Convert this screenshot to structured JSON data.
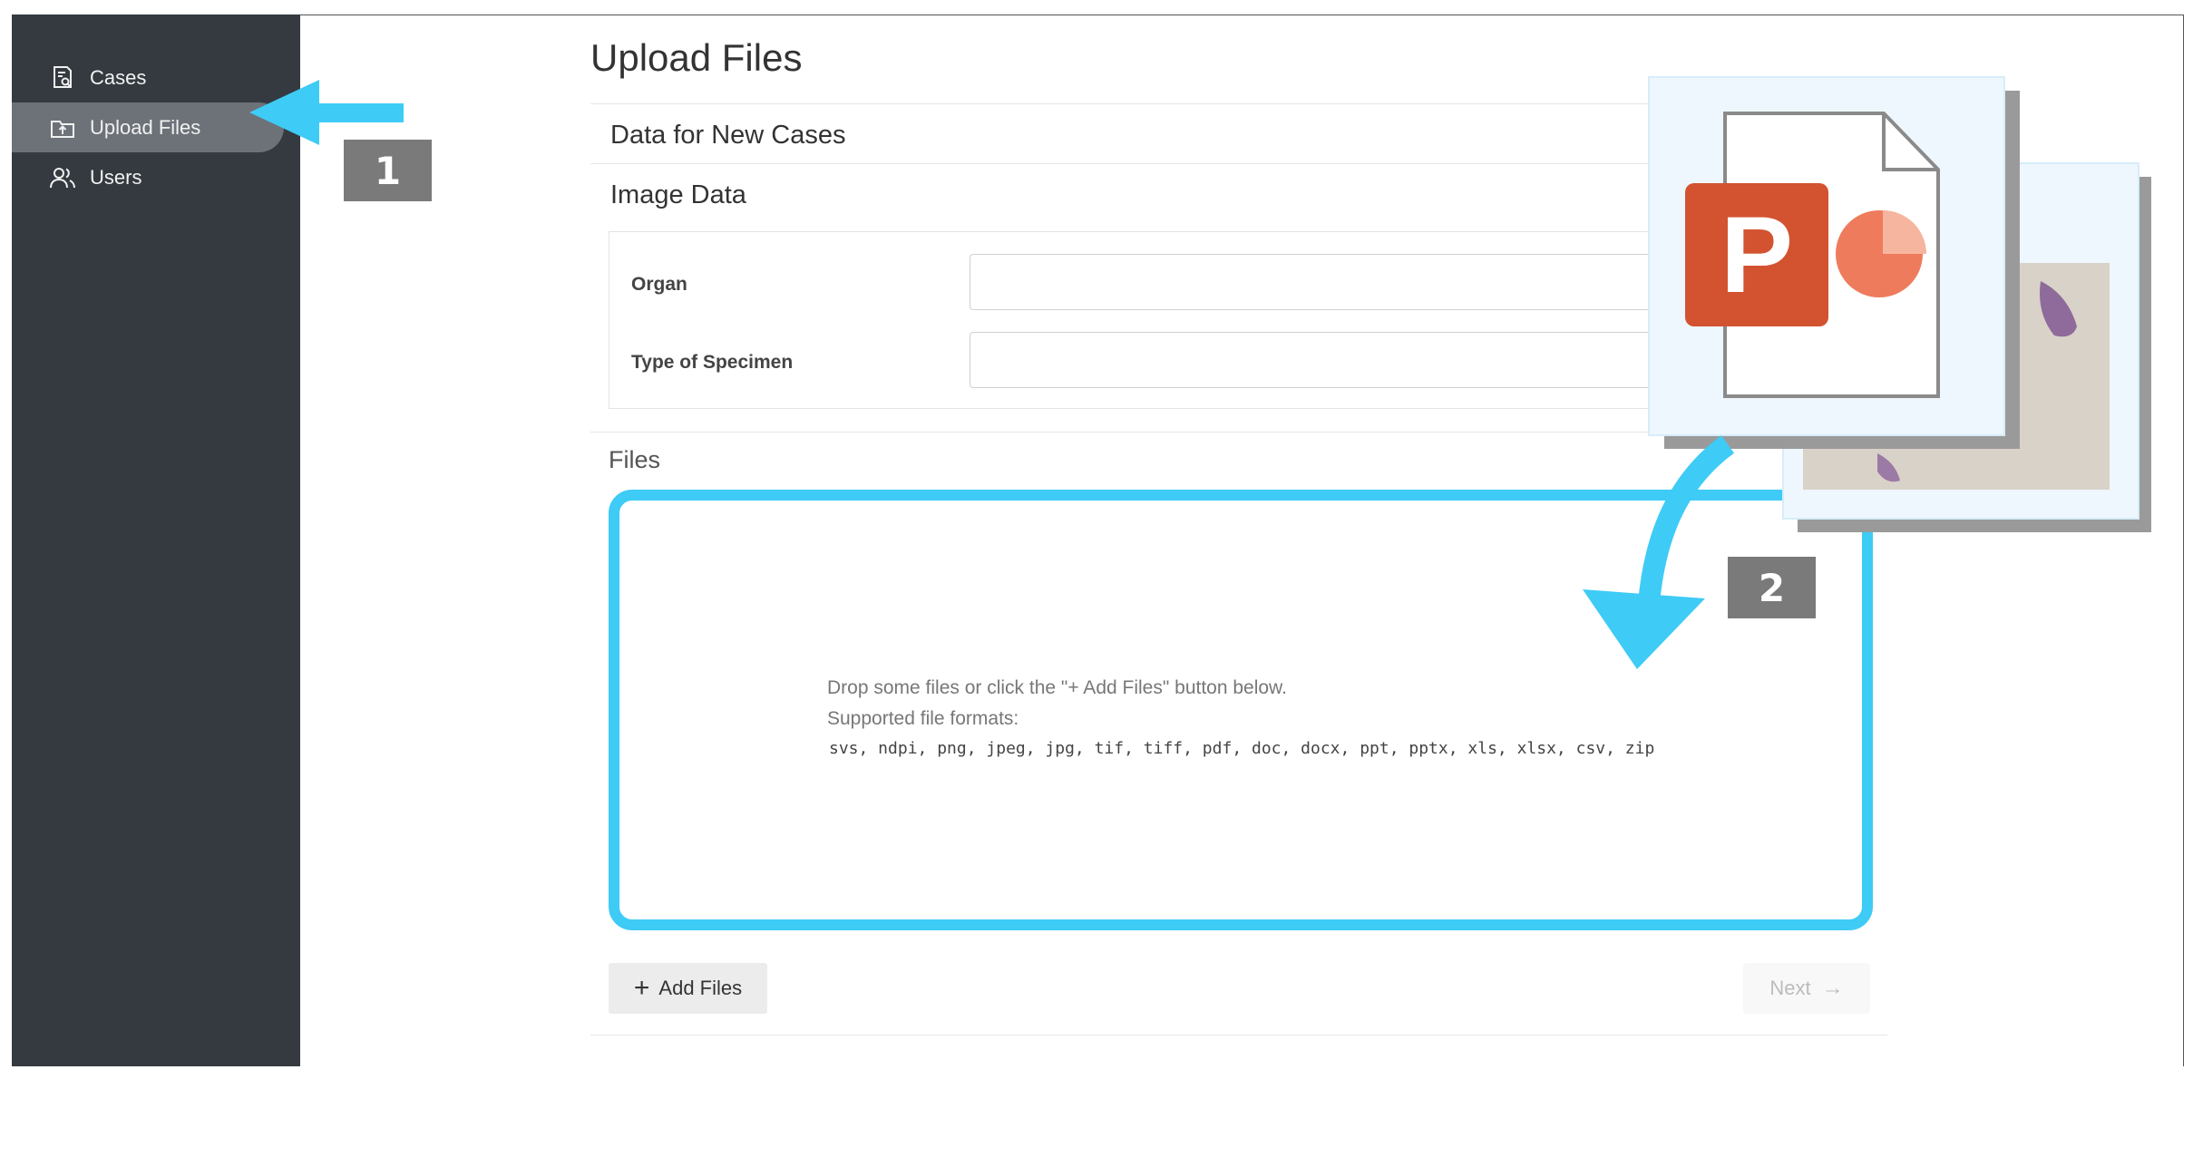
{
  "sidebar": {
    "items": [
      {
        "label": "Cases",
        "icon": "cases-icon"
      },
      {
        "label": "Upload Files",
        "icon": "upload-icon",
        "active": true
      },
      {
        "label": "Users",
        "icon": "users-icon"
      }
    ]
  },
  "annotations": {
    "step1": "1",
    "step2": "2",
    "accent_color": "#3ecbf6"
  },
  "main": {
    "title": "Upload Files",
    "section_new_cases": "Data for New Cases",
    "section_image_data": "Image Data",
    "fields": [
      {
        "label": "Organ",
        "value": ""
      },
      {
        "label": "Type of Specimen",
        "value": ""
      }
    ],
    "files_label": "Files",
    "dropzone": {
      "line1": "Drop some files or click the \"+ Add Files\" button below.",
      "line2": "Supported file formats:",
      "formats": "svs, ndpi, png, jpeg, jpg, tif, tiff, pdf, doc, docx, ppt, pptx, xls, xlsx, csv, zip"
    },
    "add_files_label": "Add Files",
    "next_label": "Next"
  },
  "dragged_file": {
    "icon": "powerpoint-file-icon",
    "letter": "P",
    "brand_color": "#d35230"
  }
}
